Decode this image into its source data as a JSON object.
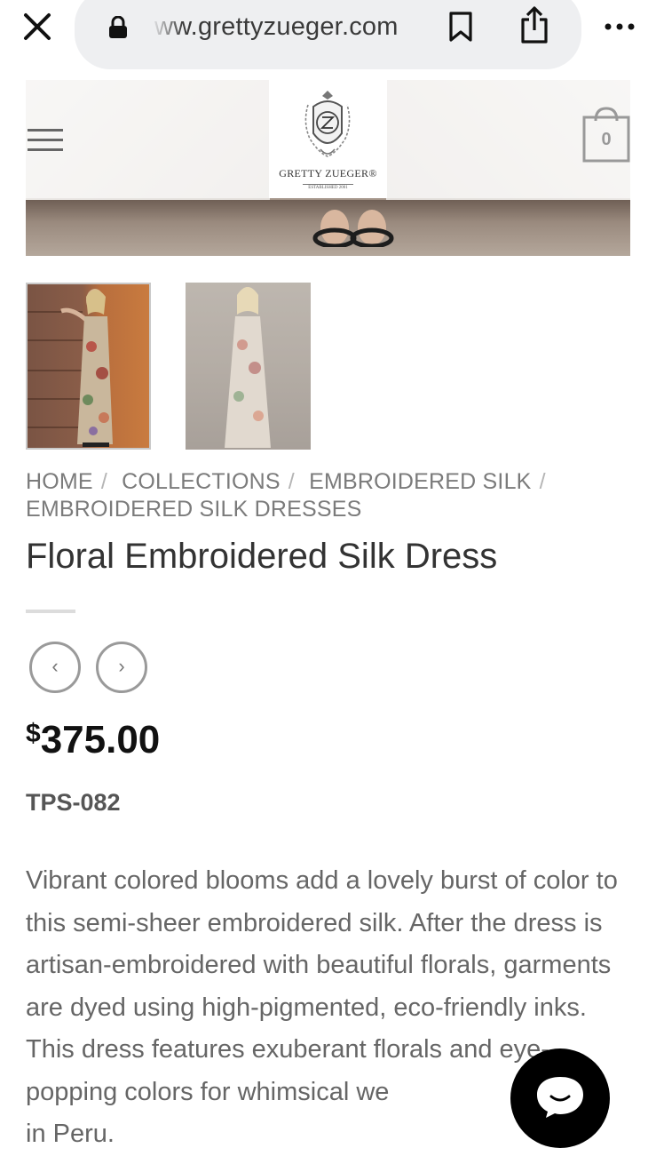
{
  "browser": {
    "url": "ww.grettyzueger.com",
    "close_icon": "close-icon",
    "lock_icon": "lock-icon",
    "bookmark_icon": "bookmark-icon",
    "share_icon": "share-icon",
    "more_icon": "more-icon"
  },
  "header": {
    "logo_name": "GRETTY ZUEGER®",
    "logo_tagline": "ESTABLISHED 2001",
    "menu_icon": "hamburger-menu-icon",
    "cart_count": "0"
  },
  "gallery": {
    "thumbnails": [
      "product-thumbnail-1",
      "product-thumbnail-2"
    ]
  },
  "breadcrumb": {
    "items": [
      "HOME",
      "COLLECTIONS",
      "EMBROIDERED SILK",
      "EMBROIDERED SILK DRESSES"
    ],
    "separator": "/"
  },
  "product": {
    "title": "Floral Embroidered Silk Dress",
    "price_currency": "$",
    "price_amount": "375.00",
    "sku": "TPS-082",
    "description": "Vibrant colored blooms add a lovely burst of color to this semi-sheer embroidered silk. After the dress is artisan-embroidered with beautiful florals, garments are dyed using high-pigmented, eco-friendly inks. This dress features exuberant florals and eye-popping colors for whimsical we",
    "description_tail": "in Peru.",
    "prev_label": "‹",
    "next_label": "›"
  },
  "chat": {
    "icon": "chat-icon"
  },
  "colors": {
    "accent_dark": "#000000",
    "text_muted": "#7b7b7b",
    "price": "#111111"
  }
}
